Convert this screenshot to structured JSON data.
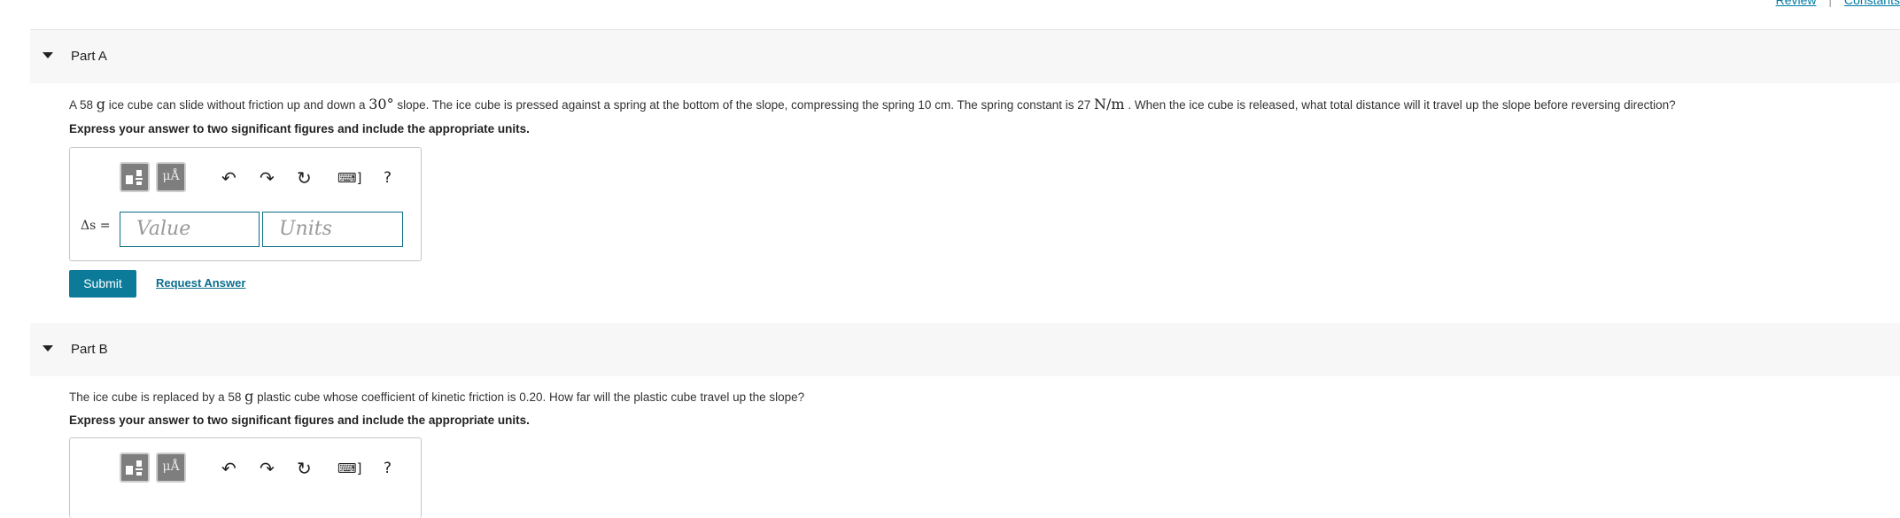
{
  "top_links": {
    "review": "Review",
    "sep": "|",
    "constants": "Constants"
  },
  "parts": [
    {
      "title": "Part A",
      "question_pre": "A 58 ",
      "q_mass_unit": "g",
      "question_mid1": " ice cube can slide without friction up and down a ",
      "q_angle": "30°",
      "question_mid2": " slope. The ice cube is pressed against a spring at the bottom of the slope, compressing the spring 10 ",
      "q_len_unit": "cm",
      "question_mid3": ". The spring constant is 27 ",
      "q_k_unit": "N/m",
      "question_post": " . When the ice cube is released, what total distance will it travel up the slope before reversing direction?",
      "instruction": "Express your answer to two significant figures and include the appropriate units.",
      "answer_label": "Δs =",
      "value_placeholder": "Value",
      "units_placeholder": "Units",
      "submit_label": "Submit",
      "request_label": "Request Answer"
    },
    {
      "title": "Part B",
      "question_pre": "The ice cube is replaced by a 58 ",
      "q_mass_unit": "g",
      "question_post": " plastic cube whose coefficient of kinetic friction is 0.20. How far will the plastic cube travel up the slope?",
      "instruction": "Express your answer to two significant figures and include the appropriate units."
    }
  ],
  "toolbar": {
    "templates_icon": "templates-icon",
    "units_label": "μÅ",
    "undo": "↶",
    "redo": "↷",
    "reset": "↻",
    "keyboard": "⌨]",
    "help": "?"
  }
}
